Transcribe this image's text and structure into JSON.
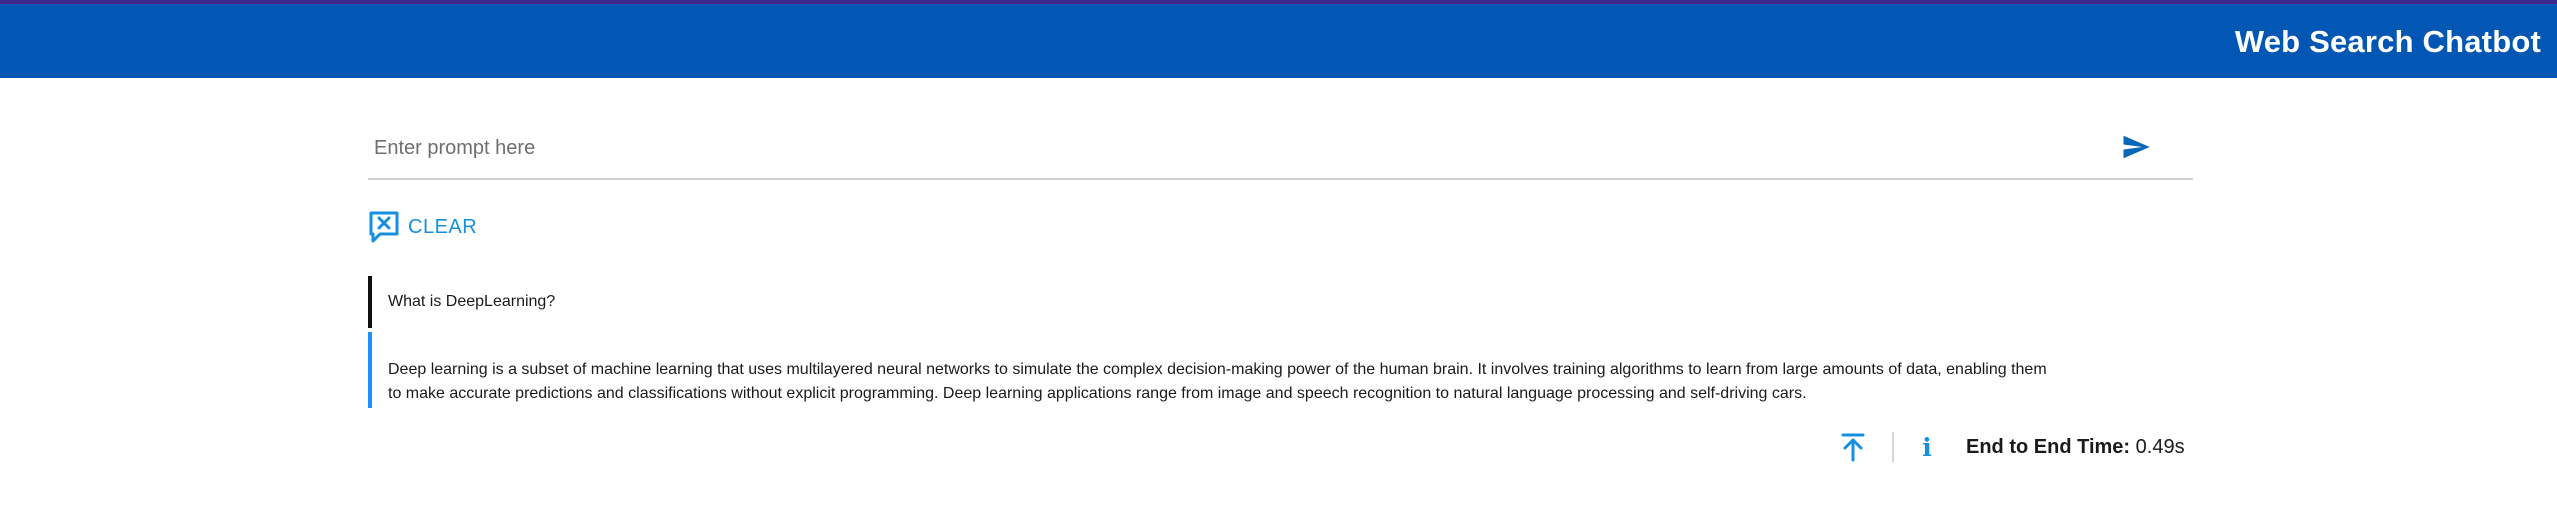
{
  "header": {
    "title": "Web Search Chatbot"
  },
  "prompt": {
    "placeholder": "Enter prompt here",
    "value": ""
  },
  "actions": {
    "clear_label": "CLEAR"
  },
  "conversation": [
    {
      "role": "user",
      "text": "What is DeepLearning?"
    },
    {
      "role": "assistant",
      "text": "Deep learning is a subset of machine learning that uses multilayered neural networks to simulate the complex decision-making power of the human brain. It involves training algorithms to learn from large amounts of data, enabling them to make accurate predictions and classifications without explicit programming. Deep learning applications range from image and speech recognition to natural language processing and self-driving cars."
    }
  ],
  "footer": {
    "timing_label": "End to End Time:",
    "timing_value": "0.49s"
  },
  "icons": {
    "send": "send-icon",
    "clear": "clear-chat-icon",
    "scroll_top": "scroll-to-top-icon",
    "info": "info-icon"
  },
  "colors": {
    "header_bg": "#0256b4",
    "header_top_border": "#3b2a8a",
    "accent": "#1590e0",
    "user_border": "#111111",
    "assistant_border": "#1e90ff"
  }
}
